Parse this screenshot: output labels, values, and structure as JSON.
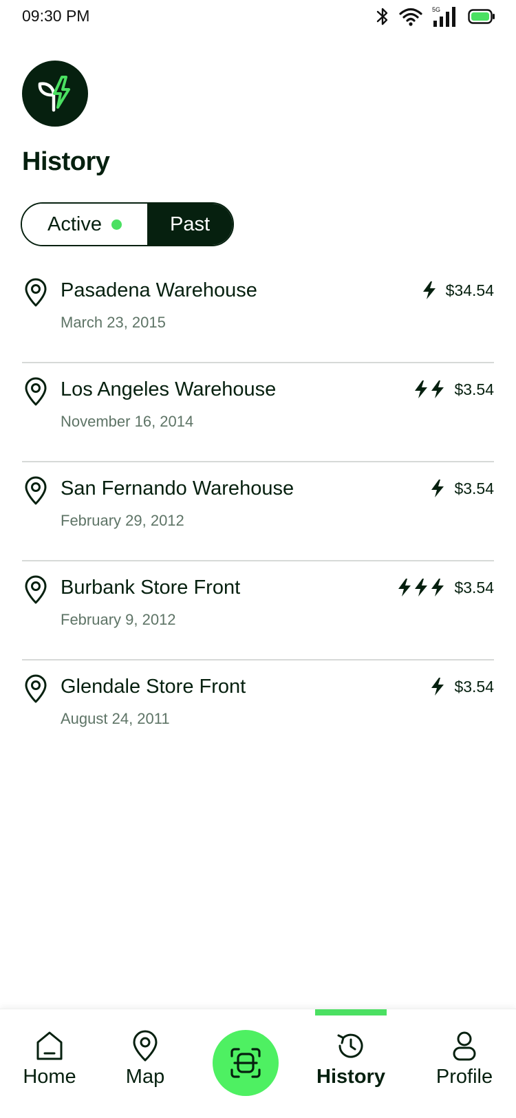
{
  "status_bar": {
    "time": "09:30 PM",
    "network": "5G"
  },
  "header": {
    "title": "History"
  },
  "segment": {
    "active_label": "Active",
    "past_label": "Past",
    "selected": "Past"
  },
  "history": {
    "items": [
      {
        "name": "Pasadena Warehouse",
        "date": "March 23, 2015",
        "price": "$34.54",
        "bolts": 1
      },
      {
        "name": "Los Angeles Warehouse",
        "date": "November 16, 2014",
        "price": "$3.54",
        "bolts": 2
      },
      {
        "name": "San Fernando Warehouse",
        "date": "February 29, 2012",
        "price": "$3.54",
        "bolts": 1
      },
      {
        "name": "Burbank Store Front",
        "date": "February 9, 2012",
        "price": "$3.54",
        "bolts": 3
      },
      {
        "name": "Glendale Store Front",
        "date": "August 24, 2011",
        "price": "$3.54",
        "bolts": 1
      }
    ]
  },
  "nav": {
    "home": "Home",
    "map": "Map",
    "history": "History",
    "profile": "Profile",
    "current": "History"
  },
  "colors": {
    "brand_dark": "#06200f",
    "accent_green": "#4be062",
    "muted_text": "#5e7466",
    "divider": "#d6d9d7"
  }
}
